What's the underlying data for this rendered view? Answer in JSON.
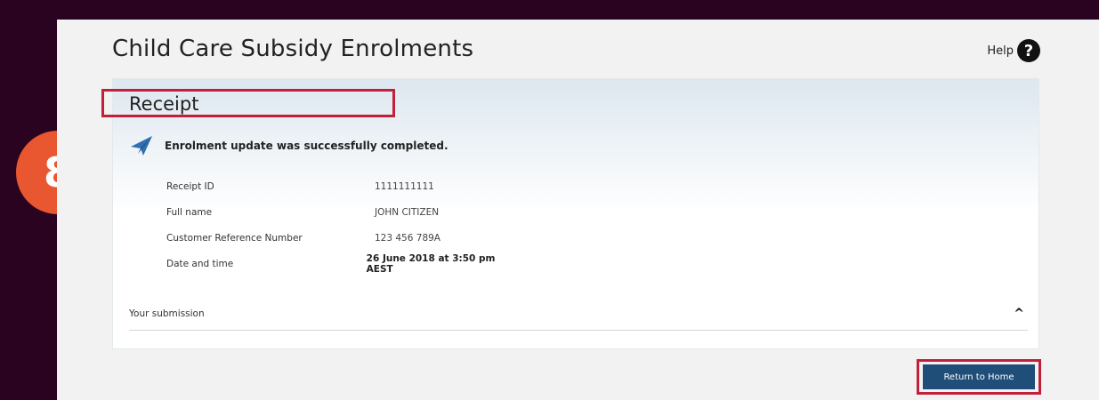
{
  "header": {
    "title": "Child Care Subsidy Enrolments",
    "help_label": "Help",
    "help_icon": "question-mark-icon"
  },
  "receipt": {
    "title": "Receipt",
    "success_icon": "paper-plane-icon",
    "success_message": "Enrolment update was successfully completed.",
    "details": [
      {
        "label": "Receipt ID",
        "value": "1111111111"
      },
      {
        "label": "Full name",
        "value": "JOHN CITIZEN"
      },
      {
        "label": "Customer Reference Number",
        "value": "123 456 789A"
      },
      {
        "label": "Date and time",
        "value": "26 June 2018 at 3:50 pm AEST"
      }
    ],
    "submission_label": "Your submission",
    "submission_toggle_icon": "chevron-up-icon"
  },
  "actions": {
    "return_home_label": "Return to Home"
  },
  "annotation": {
    "step_number": "8",
    "badge_color": "#e8572f",
    "highlight_color": "#c21f3a"
  },
  "colors": {
    "background_frame": "#2a0320",
    "page_background": "#f2f2f2",
    "primary_button": "#1f4e79"
  }
}
